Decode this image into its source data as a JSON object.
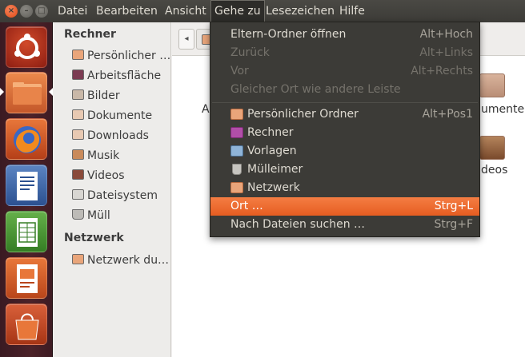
{
  "menubar": {
    "window_buttons": {
      "close": "×",
      "minimize": "–",
      "maximize": "□"
    },
    "items": [
      {
        "label": "Datei"
      },
      {
        "label": "Bearbeiten"
      },
      {
        "label": "Ansicht"
      },
      {
        "label": "Gehe zu"
      },
      {
        "label": "Lesezeichen"
      },
      {
        "label": "Hilfe"
      }
    ],
    "open_menu": "Gehe zu"
  },
  "launcher": {
    "items": [
      {
        "name": "dash-home",
        "icon": "ubuntu-logo-icon"
      },
      {
        "name": "files",
        "icon": "folder-icon",
        "active": true
      },
      {
        "name": "firefox",
        "icon": "firefox-icon"
      },
      {
        "name": "writer",
        "icon": "libreoffice-writer-icon"
      },
      {
        "name": "calc",
        "icon": "libreoffice-calc-icon"
      },
      {
        "name": "impress",
        "icon": "libreoffice-impress-icon"
      },
      {
        "name": "software-center",
        "icon": "shopping-bag-icon"
      }
    ]
  },
  "sidebar": {
    "sections": [
      {
        "heading": "Rechner",
        "items": [
          {
            "label": "Persönlicher …",
            "icon": "home-folder-icon"
          },
          {
            "label": "Arbeitsfläche",
            "icon": "desktop-icon"
          },
          {
            "label": "Bilder",
            "icon": "pictures-folder-icon"
          },
          {
            "label": "Dokumente",
            "icon": "documents-folder-icon"
          },
          {
            "label": "Downloads",
            "icon": "downloads-folder-icon"
          },
          {
            "label": "Musik",
            "icon": "music-folder-icon"
          },
          {
            "label": "Videos",
            "icon": "videos-folder-icon"
          },
          {
            "label": "Dateisystem",
            "icon": "filesystem-icon"
          },
          {
            "label": "Müll",
            "icon": "trash-icon"
          }
        ]
      },
      {
        "heading": "Netzwerk",
        "items": [
          {
            "label": "Netzwerk du…",
            "icon": "network-icon"
          }
        ]
      }
    ]
  },
  "main": {
    "toolbar": {
      "back_label": "◂"
    },
    "files": {
      "partial_left": "A",
      "dokumente": "umente",
      "videos": "deos"
    }
  },
  "dropdown": {
    "items": [
      {
        "label": "Eltern-Ordner öffnen",
        "accel": "Alt+Hoch",
        "enabled": true
      },
      {
        "label": "Zurück",
        "accel": "Alt+Links",
        "enabled": false
      },
      {
        "label": "Vor",
        "accel": "Alt+Rechts",
        "enabled": false
      },
      {
        "label": "Gleicher Ort wie andere Leiste",
        "accel": "",
        "enabled": false
      },
      {
        "label": "Persönlicher Ordner",
        "accel": "Alt+Pos1",
        "enabled": true,
        "icon": "home-folder-icon"
      },
      {
        "label": "Rechner",
        "accel": "",
        "enabled": true,
        "icon": "computer-icon"
      },
      {
        "label": "Vorlagen",
        "accel": "",
        "enabled": true,
        "icon": "templates-icon"
      },
      {
        "label": "Mülleimer",
        "accel": "",
        "enabled": true,
        "icon": "trash-icon"
      },
      {
        "label": "Netzwerk",
        "accel": "",
        "enabled": true,
        "icon": "network-icon"
      },
      {
        "label": "Ort …",
        "accel": "Strg+L",
        "enabled": true,
        "highlighted": true
      },
      {
        "label": "Nach Dateien suchen …",
        "accel": "Strg+F",
        "enabled": true
      }
    ]
  },
  "colors": {
    "accent": "#e95420",
    "menubar": "#3c3b37",
    "launcher": "#4c2229"
  }
}
